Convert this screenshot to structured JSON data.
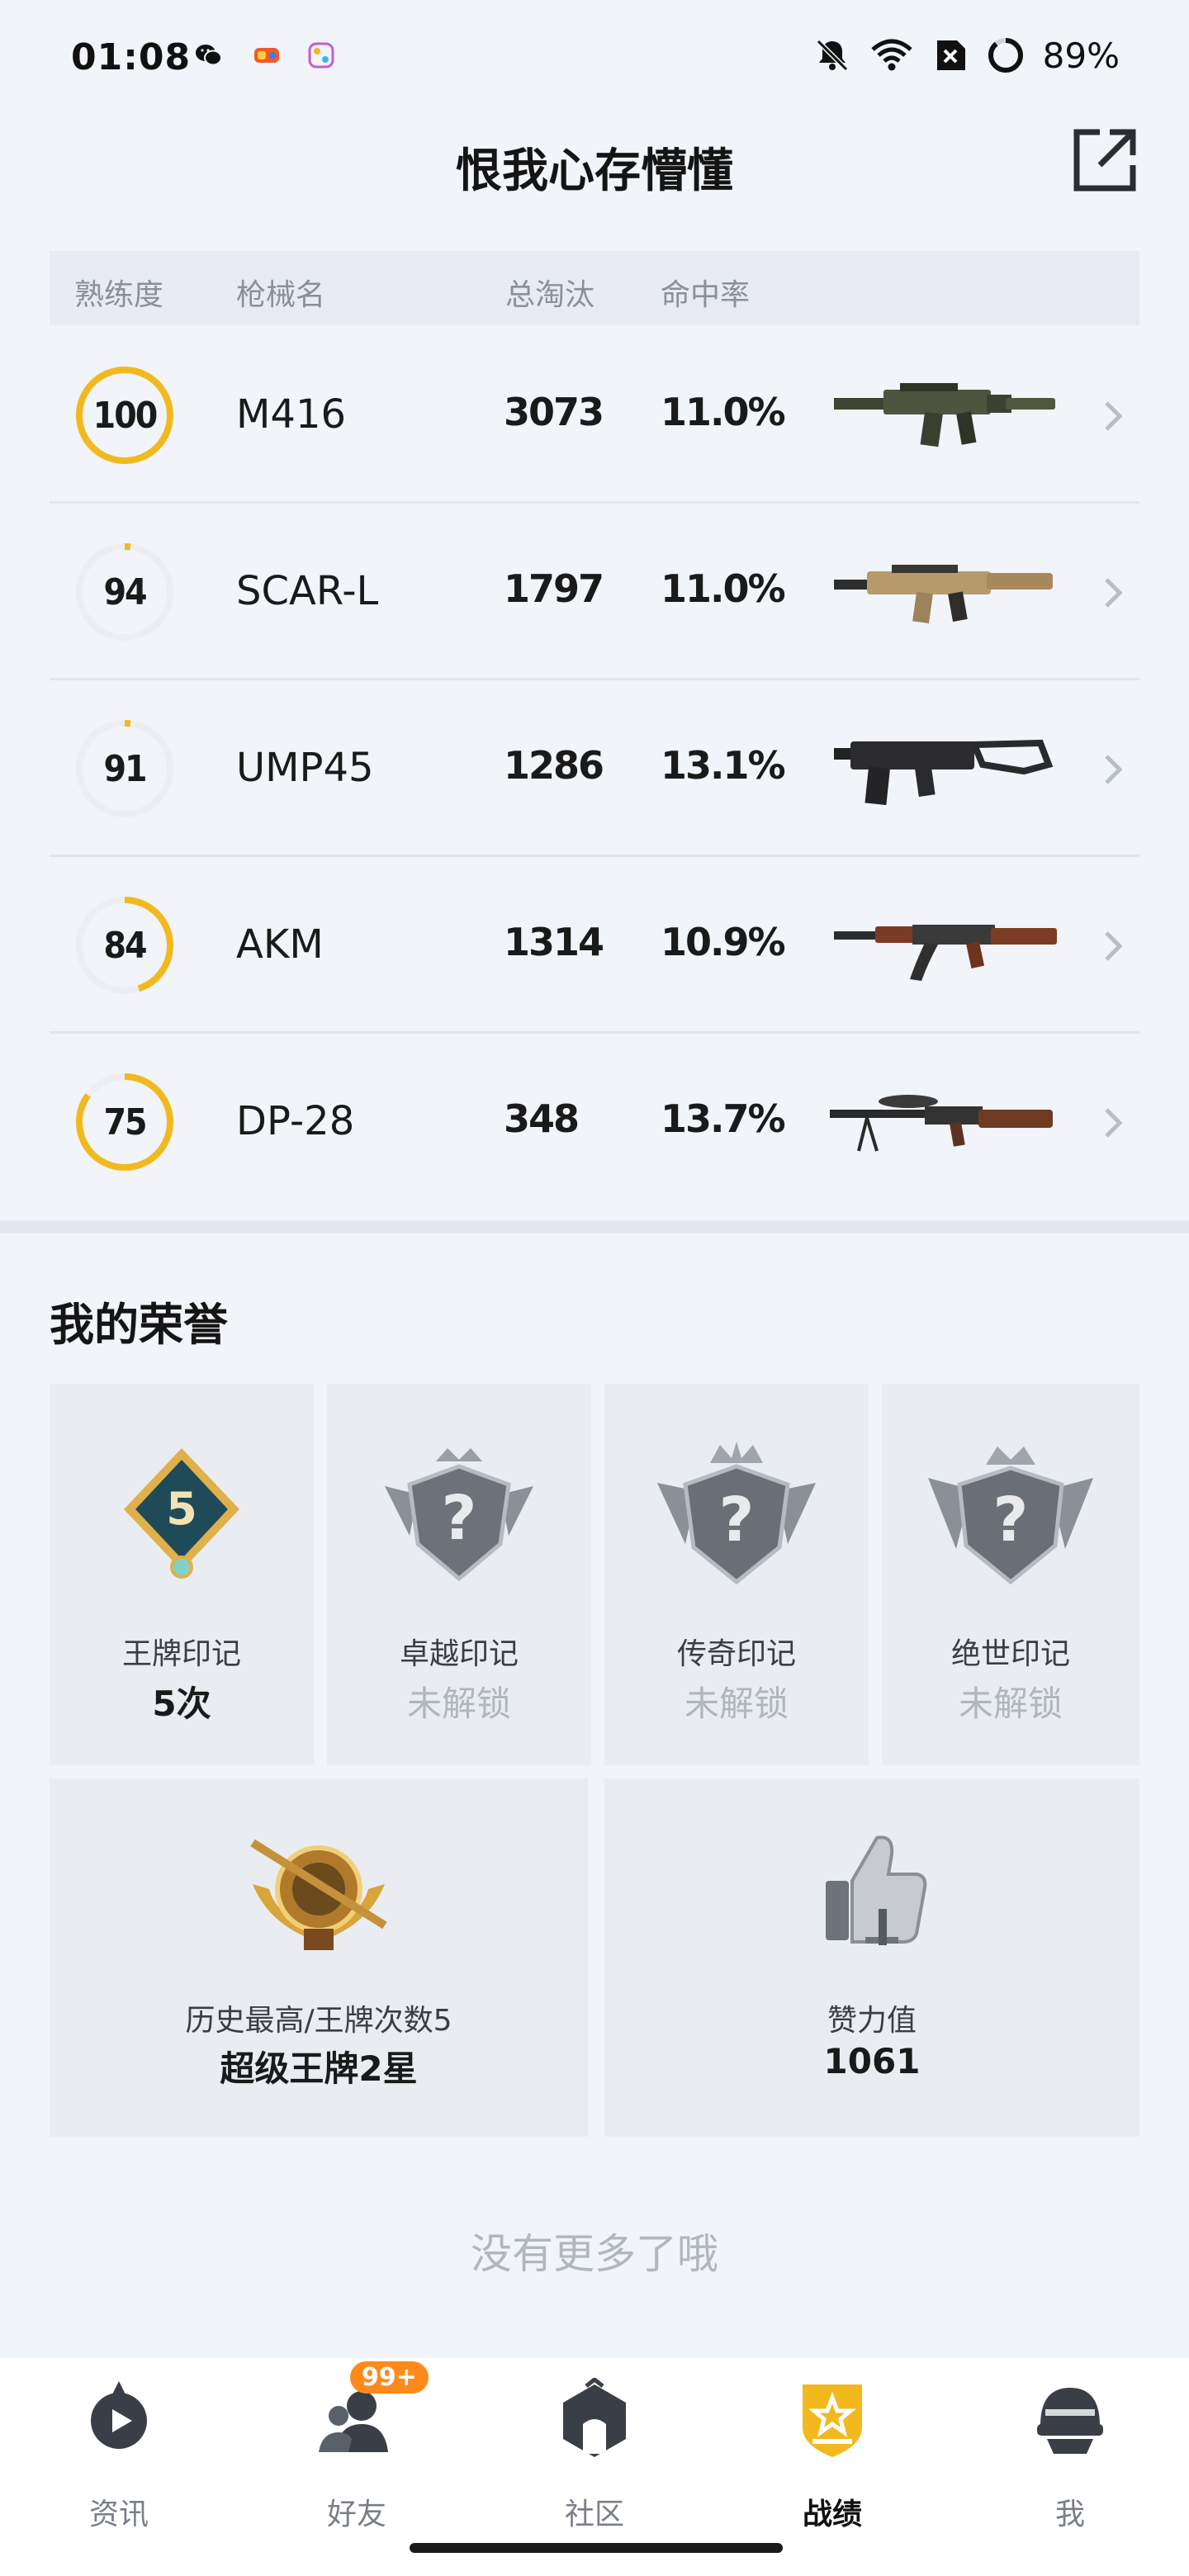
{
  "status_bar": {
    "time": "01:08",
    "battery": "89%",
    "battery_level": 0.89
  },
  "header": {
    "title": "恨我心存懵懂",
    "share_icon": "share-external-icon"
  },
  "table": {
    "headers": [
      "熟练度",
      "枪械名",
      "总淘汰",
      "命中率"
    ],
    "rows": [
      {
        "mastery": "100",
        "mastery_fraction": 1.0,
        "name": "M416",
        "kills": "3073",
        "hit_rate": "11.0%",
        "image": "m416-rifle"
      },
      {
        "mastery": "94",
        "mastery_fraction": 0.02,
        "name": "SCAR-L",
        "kills": "1797",
        "hit_rate": "11.0%",
        "image": "scar-l-rifle"
      },
      {
        "mastery": "91",
        "mastery_fraction": 0.02,
        "name": "UMP45",
        "kills": "1286",
        "hit_rate": "13.1%",
        "image": "ump45-smg"
      },
      {
        "mastery": "84",
        "mastery_fraction": 0.45,
        "name": "AKM",
        "kills": "1314",
        "hit_rate": "10.9%",
        "image": "akm-rifle"
      },
      {
        "mastery": "75",
        "mastery_fraction": 0.85,
        "name": "DP-28",
        "kills": "348",
        "hit_rate": "13.7%",
        "image": "dp28-lmg"
      }
    ]
  },
  "honors": {
    "title": "我的荣誉",
    "badges": [
      {
        "label": "王牌印记",
        "value": "5次",
        "locked": false,
        "badge_number": "5"
      },
      {
        "label": "卓越印记",
        "value": "未解锁",
        "locked": true
      },
      {
        "label": "传奇印记",
        "value": "未解锁",
        "locked": true
      },
      {
        "label": "绝世印记",
        "value": "未解锁",
        "locked": true
      }
    ],
    "highest": {
      "label": "历史最高/王牌次数5",
      "value": "超级王牌2星"
    },
    "likes": {
      "label": "赞力值",
      "value": "1061"
    }
  },
  "footer_text": "没有更多了哦",
  "nav": {
    "items": [
      {
        "label": "资讯",
        "icon": "news-icon",
        "active": false
      },
      {
        "label": "好友",
        "icon": "friends-icon",
        "active": false,
        "badge": "99+"
      },
      {
        "label": "社区",
        "icon": "community-icon",
        "active": false
      },
      {
        "label": "战绩",
        "icon": "record-icon",
        "active": true
      },
      {
        "label": "我",
        "icon": "profile-icon",
        "active": false
      }
    ]
  },
  "colors": {
    "accent": "#f2b91f",
    "ring_track": "#eceef2",
    "badge": "#ff8a1c"
  }
}
